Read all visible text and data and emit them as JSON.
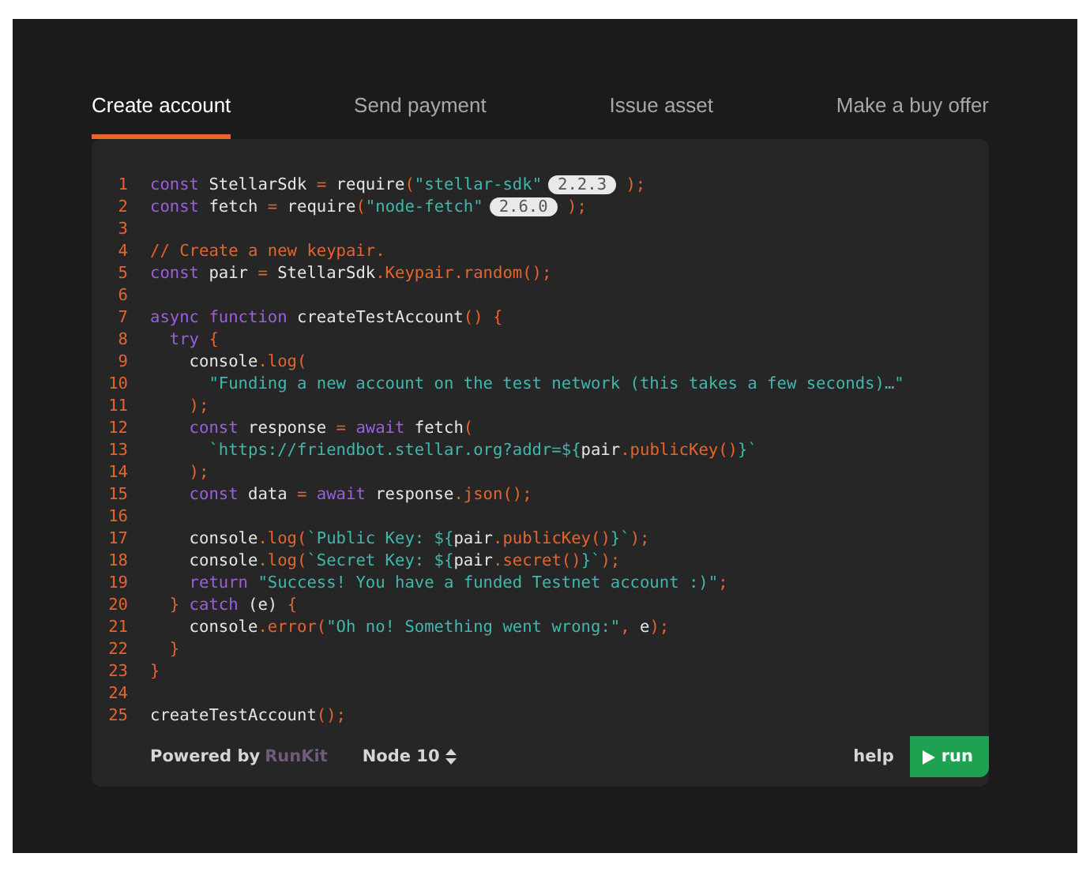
{
  "tabs": [
    {
      "label": "Create account",
      "selected": true
    },
    {
      "label": "Send payment",
      "selected": false
    },
    {
      "label": "Issue asset",
      "selected": false
    },
    {
      "label": "Make a buy offer",
      "selected": false
    }
  ],
  "code": {
    "lines": [
      {
        "number": "1",
        "tokens": [
          {
            "kind": "kw",
            "text": "const"
          },
          {
            "kind": "plain",
            "text": " StellarSdk "
          },
          {
            "kind": "op",
            "text": "="
          },
          {
            "kind": "plain",
            "text": " require"
          },
          {
            "kind": "op",
            "text": "("
          },
          {
            "kind": "str",
            "text": "\"stellar-sdk\""
          },
          {
            "kind": "badge",
            "text": "2.2.3"
          },
          {
            "kind": "op",
            "text": " );"
          }
        ]
      },
      {
        "number": "2",
        "tokens": [
          {
            "kind": "kw",
            "text": "const"
          },
          {
            "kind": "plain",
            "text": " fetch "
          },
          {
            "kind": "op",
            "text": "="
          },
          {
            "kind": "plain",
            "text": " require"
          },
          {
            "kind": "op",
            "text": "("
          },
          {
            "kind": "str",
            "text": "\"node-fetch\""
          },
          {
            "kind": "badge",
            "text": "2.6.0"
          },
          {
            "kind": "op",
            "text": " );"
          }
        ]
      },
      {
        "number": "3"
      },
      {
        "number": "4",
        "tokens": [
          {
            "kind": "comment",
            "text": "// Create a new keypair."
          }
        ]
      },
      {
        "number": "5",
        "tokens": [
          {
            "kind": "kw",
            "text": "const"
          },
          {
            "kind": "plain",
            "text": " pair "
          },
          {
            "kind": "op",
            "text": "="
          },
          {
            "kind": "plain",
            "text": " StellarSdk"
          },
          {
            "kind": "op",
            "text": ".Keypair.random();"
          }
        ]
      },
      {
        "number": "6"
      },
      {
        "number": "7",
        "tokens": [
          {
            "kind": "kw",
            "text": "async function"
          },
          {
            "kind": "plain",
            "text": " createTestAccount"
          },
          {
            "kind": "op",
            "text": "() {"
          }
        ]
      },
      {
        "number": "8",
        "tokens": [
          {
            "kind": "kw",
            "text": "  try"
          },
          {
            "kind": "op",
            "text": " {"
          }
        ]
      },
      {
        "number": "9",
        "tokens": [
          {
            "kind": "plain",
            "text": "    console"
          },
          {
            "kind": "op",
            "text": ".log("
          }
        ]
      },
      {
        "number": "10",
        "tokens": [
          {
            "kind": "str",
            "text": "      \"Funding a new account on the test network (this takes a few seconds)…\""
          }
        ]
      },
      {
        "number": "11",
        "tokens": [
          {
            "kind": "op",
            "text": "    );"
          }
        ]
      },
      {
        "number": "12",
        "tokens": [
          {
            "kind": "kw",
            "text": "    const"
          },
          {
            "kind": "plain",
            "text": " response "
          },
          {
            "kind": "op",
            "text": "="
          },
          {
            "kind": "kw",
            "text": " await"
          },
          {
            "kind": "plain",
            "text": " fetch"
          },
          {
            "kind": "op",
            "text": "("
          }
        ]
      },
      {
        "number": "13",
        "tokens": [
          {
            "kind": "str",
            "text": "      `https://friendbot.stellar.org?addr=${"
          },
          {
            "kind": "plain",
            "text": "pair"
          },
          {
            "kind": "op",
            "text": ".publicKey()"
          },
          {
            "kind": "str",
            "text": "}`"
          }
        ]
      },
      {
        "number": "14",
        "tokens": [
          {
            "kind": "op",
            "text": "    );"
          }
        ]
      },
      {
        "number": "15",
        "tokens": [
          {
            "kind": "kw",
            "text": "    const"
          },
          {
            "kind": "plain",
            "text": " data "
          },
          {
            "kind": "op",
            "text": "="
          },
          {
            "kind": "kw",
            "text": " await"
          },
          {
            "kind": "plain",
            "text": " response"
          },
          {
            "kind": "op",
            "text": ".json();"
          }
        ]
      },
      {
        "number": "16"
      },
      {
        "number": "17",
        "tokens": [
          {
            "kind": "plain",
            "text": "    console"
          },
          {
            "kind": "op",
            "text": ".log("
          },
          {
            "kind": "str",
            "text": "`Public Key: ${"
          },
          {
            "kind": "plain",
            "text": "pair"
          },
          {
            "kind": "op",
            "text": ".publicKey()"
          },
          {
            "kind": "str",
            "text": "}`"
          },
          {
            "kind": "op",
            "text": ");"
          }
        ]
      },
      {
        "number": "18",
        "tokens": [
          {
            "kind": "plain",
            "text": "    console"
          },
          {
            "kind": "op",
            "text": ".log("
          },
          {
            "kind": "str",
            "text": "`Secret Key: ${"
          },
          {
            "kind": "plain",
            "text": "pair"
          },
          {
            "kind": "op",
            "text": ".secret()"
          },
          {
            "kind": "str",
            "text": "}`"
          },
          {
            "kind": "op",
            "text": ");"
          }
        ]
      },
      {
        "number": "19",
        "tokens": [
          {
            "kind": "kw",
            "text": "    return"
          },
          {
            "kind": "str",
            "text": " \"Success! You have a funded Testnet account :)\""
          },
          {
            "kind": "op",
            "text": ";"
          }
        ]
      },
      {
        "number": "20",
        "tokens": [
          {
            "kind": "op",
            "text": "  }"
          },
          {
            "kind": "kw",
            "text": " catch"
          },
          {
            "kind": "plain",
            "text": " (e)"
          },
          {
            "kind": "op",
            "text": " {"
          }
        ]
      },
      {
        "number": "21",
        "tokens": [
          {
            "kind": "plain",
            "text": "    console"
          },
          {
            "kind": "op",
            "text": ".error("
          },
          {
            "kind": "str",
            "text": "\"Oh no! Something went wrong:\""
          },
          {
            "kind": "op",
            "text": ","
          },
          {
            "kind": "plain",
            "text": " e"
          },
          {
            "kind": "op",
            "text": ");"
          }
        ]
      },
      {
        "number": "22",
        "tokens": [
          {
            "kind": "op",
            "text": "  }"
          }
        ]
      },
      {
        "number": "23",
        "tokens": [
          {
            "kind": "op",
            "text": "}"
          }
        ]
      },
      {
        "number": "24"
      },
      {
        "number": "25",
        "tokens": [
          {
            "kind": "plain",
            "text": "createTestAccount"
          },
          {
            "kind": "op",
            "text": "();"
          }
        ]
      }
    ]
  },
  "footer": {
    "powered_by": "Powered by",
    "brand": "RunKit",
    "runtime": "Node 10",
    "help": "help",
    "run_button": "run"
  }
}
